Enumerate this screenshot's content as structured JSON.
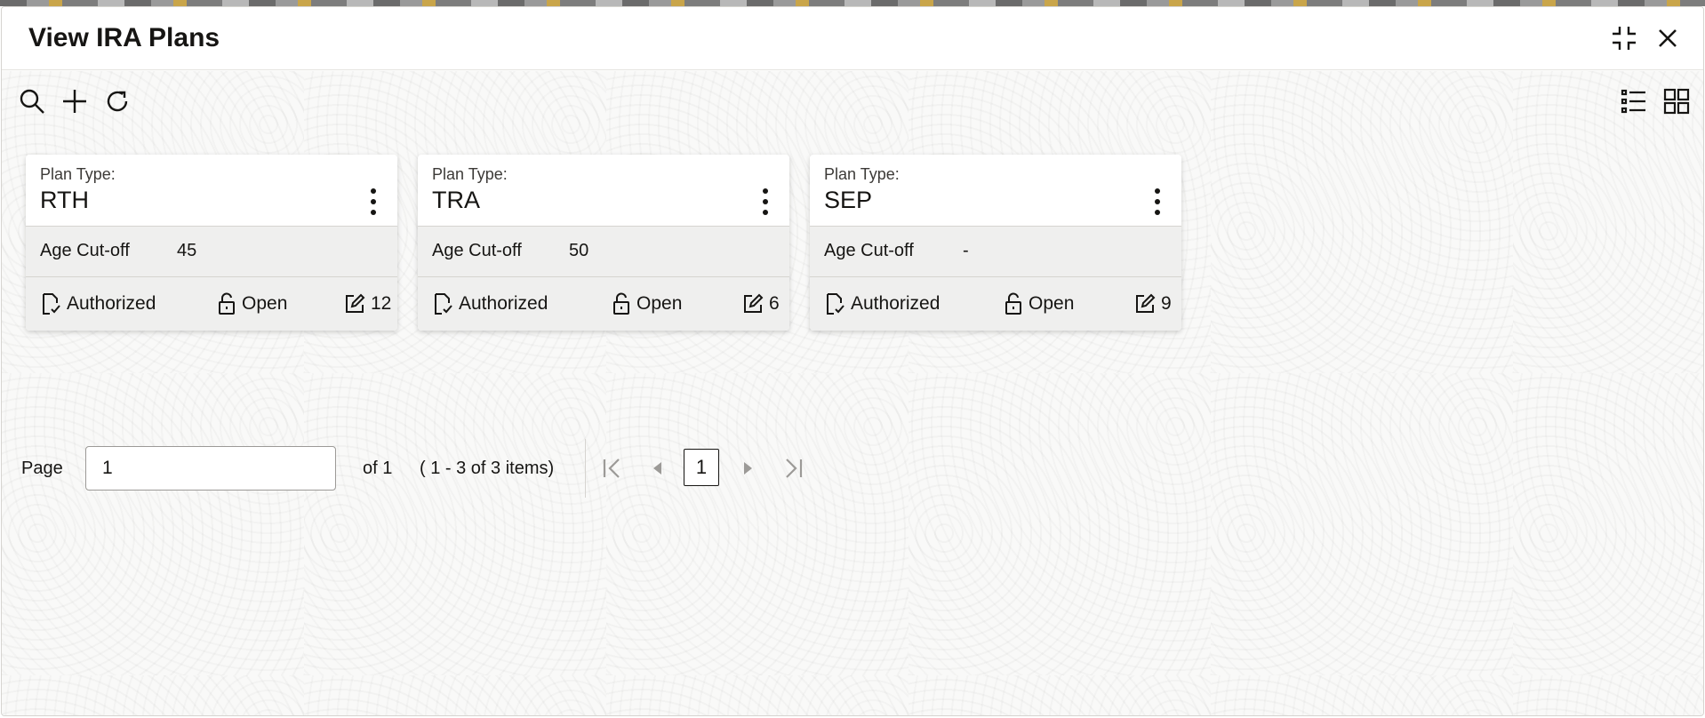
{
  "window": {
    "title": "View IRA Plans"
  },
  "pager": {
    "page_label": "Page",
    "page_value": "1",
    "of_text": "of 1",
    "items_text": "( 1 - 3 of 3 items)",
    "current_page": "1"
  },
  "cards": [
    {
      "plan_type_label": "Plan Type:",
      "plan_type": "RTH",
      "age_label": "Age Cut-off",
      "age_value": "45",
      "auth_status": "Authorized",
      "record_status": "Open",
      "modifications": "12"
    },
    {
      "plan_type_label": "Plan Type:",
      "plan_type": "TRA",
      "age_label": "Age Cut-off",
      "age_value": "50",
      "auth_status": "Authorized",
      "record_status": "Open",
      "modifications": "6"
    },
    {
      "plan_type_label": "Plan Type:",
      "plan_type": "SEP",
      "age_label": "Age Cut-off",
      "age_value": "-",
      "auth_status": "Authorized",
      "record_status": "Open",
      "modifications": "9"
    }
  ],
  "icons": {
    "minimize": "collapse-icon",
    "close": "close-icon",
    "search": "search-icon",
    "add": "plus-icon",
    "refresh": "refresh-icon",
    "list_view": "list-view-icon",
    "tile_view": "grid-view-icon"
  }
}
